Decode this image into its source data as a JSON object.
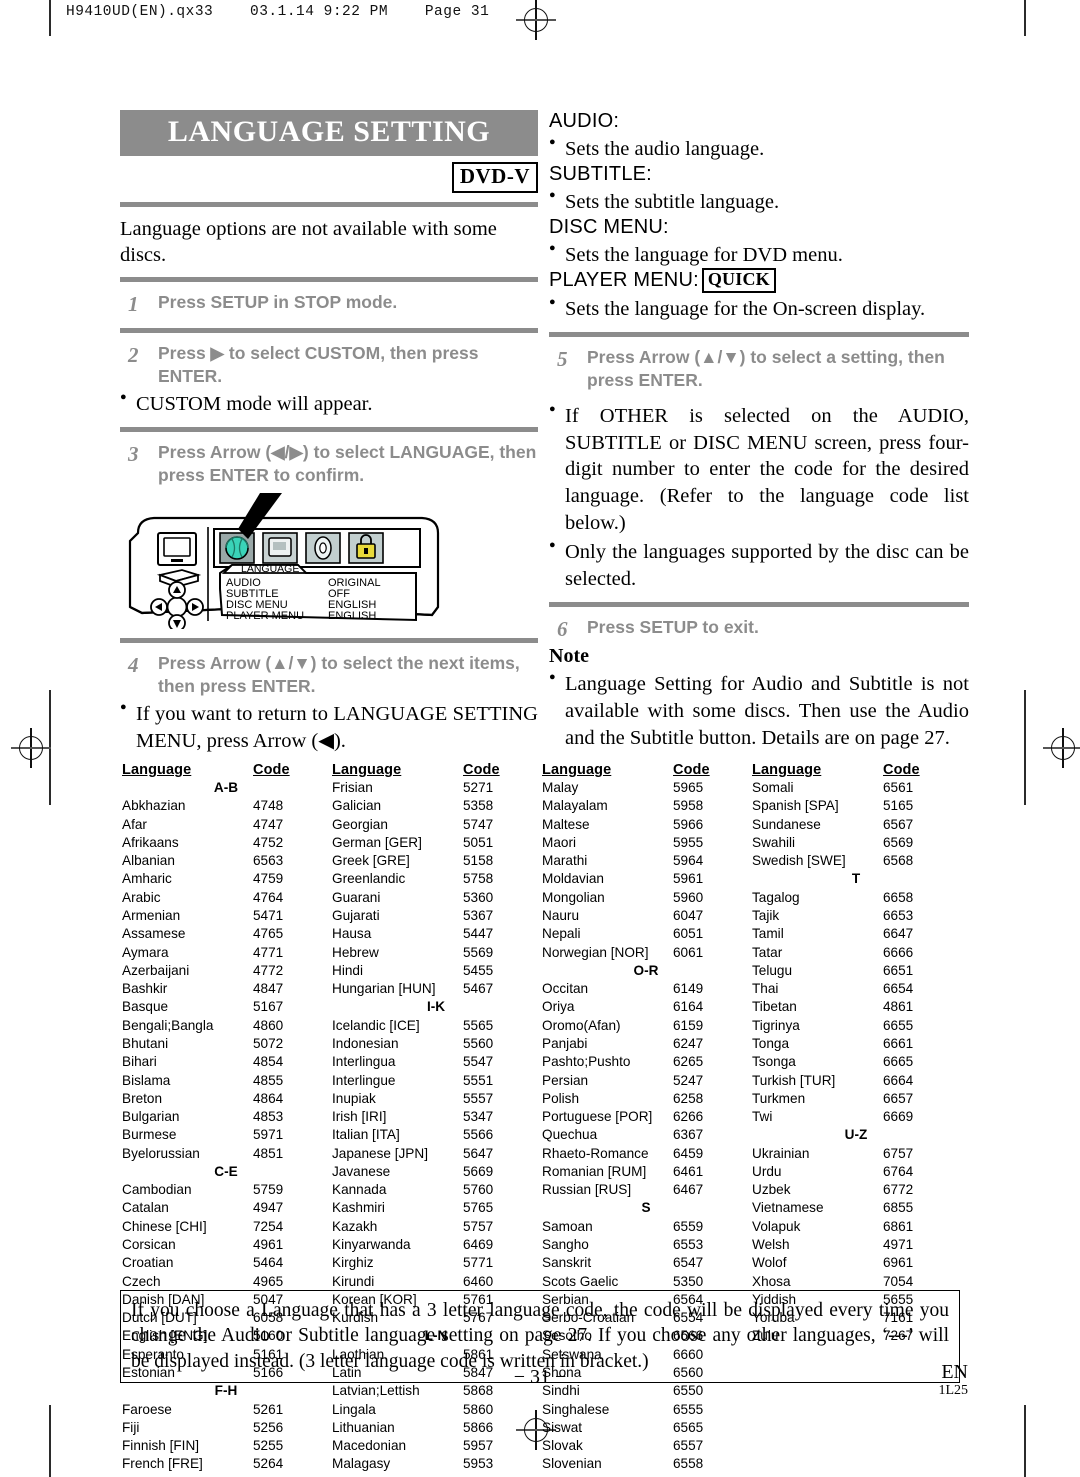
{
  "doc_header": "H9410UD(EN).qx33    03.1.14 9:22 PM    Page 31",
  "title": "LANGUAGE SETTING",
  "dvd_badge": "DVD-V",
  "intro": "Language options are not available with some discs.",
  "steps": [
    {
      "num": "1",
      "text": "Press SETUP in STOP mode."
    },
    {
      "num": "2",
      "text": "Press ▶ to select CUSTOM, then press ENTER."
    },
    {
      "num": "3",
      "text": "Press Arrow (◀/▶) to select LANGUAGE, then press ENTER to confirm."
    },
    {
      "num": "4",
      "text": "Press Arrow (▲/▼) to select the next items, then press ENTER."
    },
    {
      "num": "5",
      "text": "Press Arrow (▲/▼) to select a setting, then press ENTER."
    },
    {
      "num": "6",
      "text": "Press SETUP to exit."
    }
  ],
  "bullets": {
    "custom_mode": "CUSTOM mode will appear.",
    "return_menu": "If you want to return to LANGUAGE SETTING MENU, press Arrow (◀).",
    "other_code": "If OTHER is selected on the AUDIO, SUBTITLE or DISC MENU screen, press four-digit number to enter the code for the desired language. (Refer to the language code list below.)",
    "supported": "Only the languages supported by the disc can be selected."
  },
  "osd": {
    "menu_tab": "LANGUAGE",
    "rows": [
      {
        "label": "AUDIO",
        "value": "ORIGINAL"
      },
      {
        "label": "SUBTITLE",
        "value": "OFF"
      },
      {
        "label": "DISC MENU",
        "value": "ENGLISH"
      },
      {
        "label": "PLAYER MENU",
        "value": "ENGLISH"
      }
    ],
    "icon_colors": {
      "globe": "#3ad3b8",
      "screen": "#b9c6c6",
      "audio": "#c9d6d6",
      "lock": "#e8d93a"
    }
  },
  "settings": [
    {
      "name": "AUDIO:",
      "desc": "Sets the audio language.",
      "badge": ""
    },
    {
      "name": "SUBTITLE:",
      "desc": "Sets the subtitle language.",
      "badge": ""
    },
    {
      "name": "DISC MENU:",
      "desc": "Sets the language for DVD menu.",
      "badge": ""
    },
    {
      "name": "PLAYER MENU:",
      "desc": "Sets the language for the On-screen display.",
      "badge": "QUICK"
    }
  ],
  "note": {
    "head": "Note",
    "text": "Language Setting for Audio and Subtitle is not available with some discs. Then use the Audio and the Subtitle button. Details are on page 27."
  },
  "table": {
    "headers": {
      "language": "Language",
      "code": "Code"
    },
    "columns": [
      {
        "rows": [
          {
            "group": "A-B"
          },
          {
            "lang": "Abkhazian",
            "code": "4748"
          },
          {
            "lang": "Afar",
            "code": "4747"
          },
          {
            "lang": "Afrikaans",
            "code": "4752"
          },
          {
            "lang": "Albanian",
            "code": "6563"
          },
          {
            "lang": "Amharic",
            "code": "4759"
          },
          {
            "lang": "Arabic",
            "code": "4764"
          },
          {
            "lang": "Armenian",
            "code": "5471"
          },
          {
            "lang": "Assamese",
            "code": "4765"
          },
          {
            "lang": "Aymara",
            "code": "4771"
          },
          {
            "lang": "Azerbaijani",
            "code": "4772"
          },
          {
            "lang": "Bashkir",
            "code": "4847"
          },
          {
            "lang": "Basque",
            "code": "5167"
          },
          {
            "lang": "Bengali;Bangla",
            "code": "4860"
          },
          {
            "lang": "Bhutani",
            "code": "5072"
          },
          {
            "lang": "Bihari",
            "code": "4854"
          },
          {
            "lang": "Bislama",
            "code": "4855"
          },
          {
            "lang": "Breton",
            "code": "4864"
          },
          {
            "lang": "Bulgarian",
            "code": "4853"
          },
          {
            "lang": "Burmese",
            "code": "5971"
          },
          {
            "lang": "Byelorussian",
            "code": "4851"
          },
          {
            "group": "C-E"
          },
          {
            "lang": "Cambodian",
            "code": "5759"
          },
          {
            "lang": "Catalan",
            "code": "4947"
          },
          {
            "lang": "Chinese [CHI]",
            "code": "7254"
          },
          {
            "lang": "Corsican",
            "code": "4961"
          },
          {
            "lang": "Croatian",
            "code": "5464"
          },
          {
            "lang": "Czech",
            "code": "4965"
          },
          {
            "lang": "Danish [DAN]",
            "code": "5047"
          },
          {
            "lang": "Dutch [DUT]",
            "code": "6058"
          },
          {
            "lang": "English [ENG]",
            "code": "5160"
          },
          {
            "lang": "Esperanto",
            "code": "5161"
          },
          {
            "lang": "Estonian",
            "code": "5166"
          },
          {
            "group": "F-H"
          },
          {
            "lang": "Faroese",
            "code": "5261"
          },
          {
            "lang": "Fiji",
            "code": "5256"
          },
          {
            "lang": "Finnish [FIN]",
            "code": "5255"
          },
          {
            "lang": "French [FRE]",
            "code": "5264"
          }
        ]
      },
      {
        "rows": [
          {
            "lang": "Frisian",
            "code": "5271"
          },
          {
            "lang": "Galician",
            "code": "5358"
          },
          {
            "lang": "Georgian",
            "code": "5747"
          },
          {
            "lang": "German [GER]",
            "code": "5051"
          },
          {
            "lang": "Greek [GRE]",
            "code": "5158"
          },
          {
            "lang": "Greenlandic",
            "code": "5758"
          },
          {
            "lang": "Guarani",
            "code": "5360"
          },
          {
            "lang": "Gujarati",
            "code": "5367"
          },
          {
            "lang": "Hausa",
            "code": "5447"
          },
          {
            "lang": "Hebrew",
            "code": "5569"
          },
          {
            "lang": "Hindi",
            "code": "5455"
          },
          {
            "lang": "Hungarian [HUN]",
            "code": "5467"
          },
          {
            "group": "I-K"
          },
          {
            "lang": "Icelandic [ICE]",
            "code": "5565"
          },
          {
            "lang": "Indonesian",
            "code": "5560"
          },
          {
            "lang": "Interlingua",
            "code": "5547"
          },
          {
            "lang": "Interlingue",
            "code": "5551"
          },
          {
            "lang": "Inupiak",
            "code": "5557"
          },
          {
            "lang": "Irish [IRI]",
            "code": "5347"
          },
          {
            "lang": "Italian [ITA]",
            "code": "5566"
          },
          {
            "lang": "Japanese [JPN]",
            "code": "5647"
          },
          {
            "lang": "Javanese",
            "code": "5669"
          },
          {
            "lang": "Kannada",
            "code": "5760"
          },
          {
            "lang": "Kashmiri",
            "code": "5765"
          },
          {
            "lang": "Kazakh",
            "code": "5757"
          },
          {
            "lang": "Kinyarwanda",
            "code": "6469"
          },
          {
            "lang": "Kirghiz",
            "code": "5771"
          },
          {
            "lang": "Kirundi",
            "code": "6460"
          },
          {
            "lang": "Korean [KOR]",
            "code": "5761"
          },
          {
            "lang": "Kurdish",
            "code": "5767"
          },
          {
            "group": "L-N"
          },
          {
            "lang": "Laothian",
            "code": "5861"
          },
          {
            "lang": "Latin",
            "code": "5847"
          },
          {
            "lang": "Latvian;Lettish",
            "code": "5868"
          },
          {
            "lang": "Lingala",
            "code": "5860"
          },
          {
            "lang": "Lithuanian",
            "code": "5866"
          },
          {
            "lang": "Macedonian",
            "code": "5957"
          },
          {
            "lang": "Malagasy",
            "code": "5953"
          }
        ]
      },
      {
        "rows": [
          {
            "lang": "Malay",
            "code": "5965"
          },
          {
            "lang": "Malayalam",
            "code": "5958"
          },
          {
            "lang": "Maltese",
            "code": "5966"
          },
          {
            "lang": "Maori",
            "code": "5955"
          },
          {
            "lang": "Marathi",
            "code": "5964"
          },
          {
            "lang": "Moldavian",
            "code": "5961"
          },
          {
            "lang": "Mongolian",
            "code": "5960"
          },
          {
            "lang": "Nauru",
            "code": "6047"
          },
          {
            "lang": "Nepali",
            "code": "6051"
          },
          {
            "lang": "Norwegian [NOR]",
            "code": "6061"
          },
          {
            "group": "O-R"
          },
          {
            "lang": "Occitan",
            "code": "6149"
          },
          {
            "lang": "Oriya",
            "code": "6164"
          },
          {
            "lang": "Oromo(Afan)",
            "code": "6159"
          },
          {
            "lang": "Panjabi",
            "code": "6247"
          },
          {
            "lang": "Pashto;Pushto",
            "code": "6265"
          },
          {
            "lang": "Persian",
            "code": "5247"
          },
          {
            "lang": "Polish",
            "code": "6258"
          },
          {
            "lang": "Portuguese [POR]",
            "code": "6266"
          },
          {
            "lang": "Quechua",
            "code": "6367"
          },
          {
            "lang": "Rhaeto-Romance",
            "code": "6459"
          },
          {
            "lang": "Romanian [RUM]",
            "code": "6461"
          },
          {
            "lang": "Russian [RUS]",
            "code": "6467"
          },
          {
            "group": "S"
          },
          {
            "lang": "Samoan",
            "code": "6559"
          },
          {
            "lang": "Sangho",
            "code": "6553"
          },
          {
            "lang": "Sanskrit",
            "code": "6547"
          },
          {
            "lang": "Scots Gaelic",
            "code": "5350"
          },
          {
            "lang": "Serbian",
            "code": "6564"
          },
          {
            "lang": "Serbo-Croatian",
            "code": "6554"
          },
          {
            "lang": "Sesotho",
            "code": "6566"
          },
          {
            "lang": "Setswana",
            "code": "6660"
          },
          {
            "lang": "Shona",
            "code": "6560"
          },
          {
            "lang": "Sindhi",
            "code": "6550"
          },
          {
            "lang": "Singhalese",
            "code": "6555"
          },
          {
            "lang": "Siswat",
            "code": "6565"
          },
          {
            "lang": "Slovak",
            "code": "6557"
          },
          {
            "lang": "Slovenian",
            "code": "6558"
          }
        ]
      },
      {
        "rows": [
          {
            "lang": "Somali",
            "code": "6561"
          },
          {
            "lang": "Spanish [SPA]",
            "code": "5165"
          },
          {
            "lang": "Sundanese",
            "code": "6567"
          },
          {
            "lang": "Swahili",
            "code": "6569"
          },
          {
            "lang": "Swedish [SWE]",
            "code": "6568"
          },
          {
            "group": "T"
          },
          {
            "lang": "Tagalog",
            "code": "6658"
          },
          {
            "lang": "Tajik",
            "code": "6653"
          },
          {
            "lang": "Tamil",
            "code": "6647"
          },
          {
            "lang": "Tatar",
            "code": "6666"
          },
          {
            "lang": "Telugu",
            "code": "6651"
          },
          {
            "lang": "Thai",
            "code": "6654"
          },
          {
            "lang": "Tibetan",
            "code": "4861"
          },
          {
            "lang": "Tigrinya",
            "code": "6655"
          },
          {
            "lang": "Tonga",
            "code": "6661"
          },
          {
            "lang": "Tsonga",
            "code": "6665"
          },
          {
            "lang": "Turkish [TUR]",
            "code": "6664"
          },
          {
            "lang": "Turkmen",
            "code": "6657"
          },
          {
            "lang": "Twi",
            "code": "6669"
          },
          {
            "group": "U-Z"
          },
          {
            "lang": "Ukrainian",
            "code": "6757"
          },
          {
            "lang": "Urdu",
            "code": "6764"
          },
          {
            "lang": "Uzbek",
            "code": "6772"
          },
          {
            "lang": "Vietnamese",
            "code": "6855"
          },
          {
            "lang": "Volapuk",
            "code": "6861"
          },
          {
            "lang": "Welsh",
            "code": "4971"
          },
          {
            "lang": "Wolof",
            "code": "6961"
          },
          {
            "lang": "Xhosa",
            "code": "7054"
          },
          {
            "lang": "Yiddish",
            "code": "5655"
          },
          {
            "lang": "Yoruba",
            "code": "7161"
          },
          {
            "lang": "Zulu",
            "code": "7267"
          }
        ]
      }
    ]
  },
  "boxed_note": "If you choose a Language that has a 3 letter language code, the code will be displayed every time you change the Audio or Subtitle language setting on page 27. If you choose any other languages, ‘---’ will be displayed instead. (3 letter language code is written in bracket.)",
  "footer": {
    "page": "− 31 −",
    "lang": "EN",
    "code": "1L25"
  }
}
